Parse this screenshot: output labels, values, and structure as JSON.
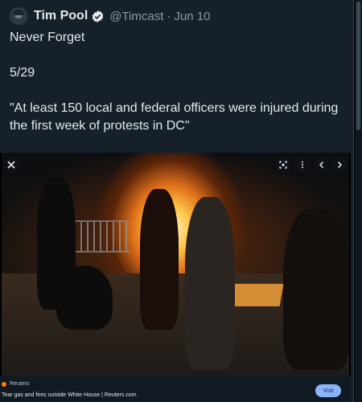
{
  "tweet": {
    "display_name": "Tim Pool",
    "handle": "@Timcast",
    "separator": "·",
    "date": "Jun 10",
    "lines": [
      "Never Forget",
      "5/29",
      "\"At least 150 local and federal officers were injured during the first week of protests in DC\""
    ]
  },
  "media": {
    "buttons": [
      "close-icon",
      "scan-icon",
      "more-icon",
      "chevron-left-icon",
      "chevron-right-icon"
    ]
  },
  "link_card": {
    "source": "Reuters",
    "caption": "Tear gas and fires outside White House | Reuters.com",
    "visit_label": "Visit",
    "button_color": "#8ab4f8"
  },
  "colors": {
    "background": "#15202b",
    "verified": "#1d9bf0",
    "secondary_text": "#8b98a5"
  }
}
